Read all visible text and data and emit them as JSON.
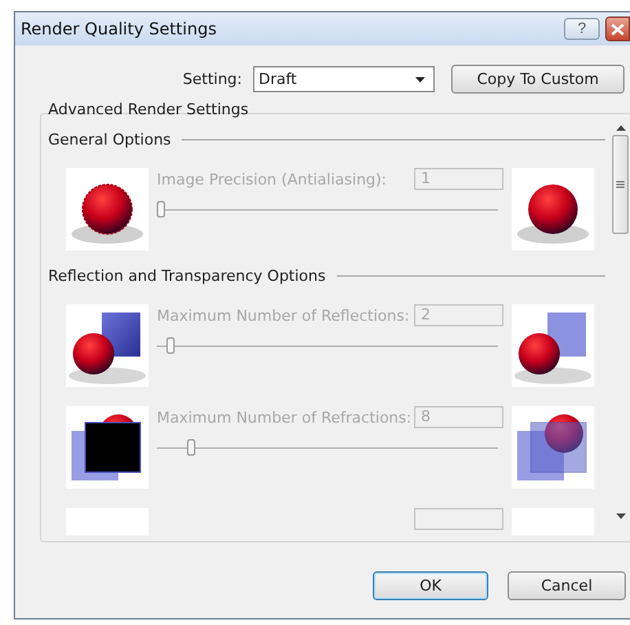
{
  "window": {
    "title": "Render Quality Settings",
    "help_button": "?"
  },
  "setting": {
    "label": "Setting:",
    "value": "Draft"
  },
  "copy_button": "Copy To Custom",
  "group": {
    "title": "Advanced Render Settings",
    "sections": [
      {
        "title": "General Options",
        "rows": [
          {
            "kind": "sphere",
            "label": "Image Precision (Antialiasing):",
            "value": "1",
            "level": 0,
            "disabled": true
          }
        ]
      },
      {
        "title": "Reflection and Transparency Options",
        "rows": [
          {
            "kind": "reflect",
            "label": "Maximum Number of Reflections:",
            "value": "2",
            "level": 0.03,
            "disabled": true
          },
          {
            "kind": "refract",
            "label": "Maximum Number of Refractions:",
            "value": "8",
            "level": 0.09,
            "disabled": true
          },
          {
            "kind": "blank",
            "disabled": true
          }
        ]
      }
    ]
  },
  "buttons": [
    "OK",
    "Cancel"
  ]
}
